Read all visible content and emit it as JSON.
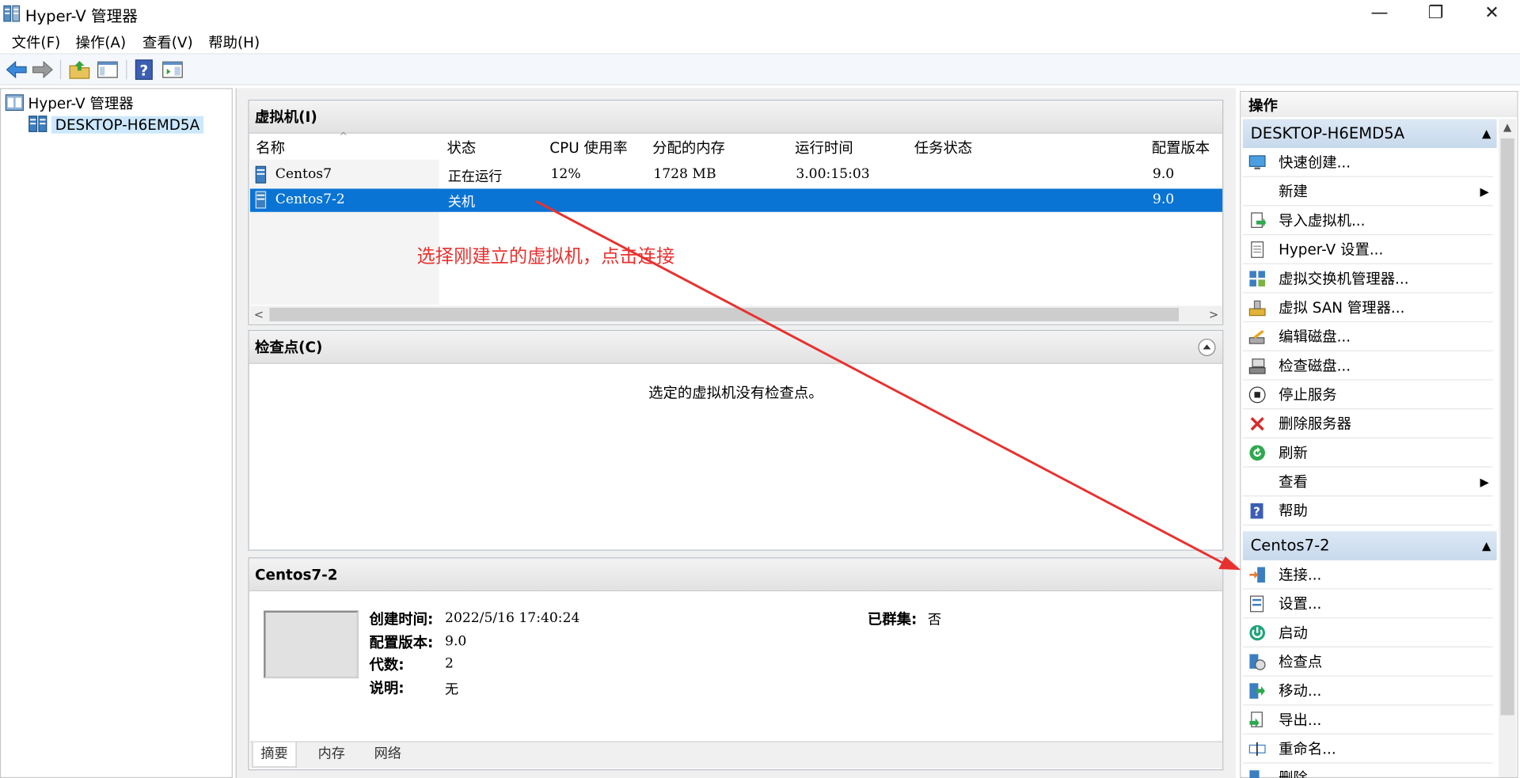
{
  "window": {
    "title": "Hyper-V 管理器",
    "minimize_glyph": "—",
    "restore_glyph": "❐",
    "close_glyph": "✕"
  },
  "menu": [
    "文件(F)",
    "操作(A)",
    "查看(V)",
    "帮助(H)"
  ],
  "tree": {
    "root": "Hyper-V 管理器",
    "server": "DESKTOP-H6EMD5A"
  },
  "vm_panel": {
    "title": "虚拟机(I)",
    "columns": [
      "名称",
      "状态",
      "CPU 使用率",
      "分配的内存",
      "运行时间",
      "任务状态",
      "配置版本"
    ],
    "rows": [
      {
        "name": "Centos7",
        "state": "正在运行",
        "cpu": "12%",
        "memory": "1728 MB",
        "uptime": "3.00:15:03",
        "task": "",
        "version": "9.0"
      },
      {
        "name": "Centos7-2",
        "state": "关机",
        "cpu": "",
        "memory": "",
        "uptime": "",
        "task": "",
        "version": "9.0"
      }
    ],
    "scroll_left": "<",
    "scroll_right": ">"
  },
  "annotation": "选择刚建立的虚拟机，点击连接",
  "checkpoint_panel": {
    "title": "检查点(C)",
    "empty_text": "选定的虚拟机没有检查点。"
  },
  "details_panel": {
    "title": "Centos7-2",
    "fields": [
      {
        "label": "创建时间:",
        "value": "2022/5/16 17:40:24"
      },
      {
        "label": "配置版本:",
        "value": "9.0"
      },
      {
        "label": "代数:",
        "value": "2"
      },
      {
        "label": "说明:",
        "value": "无"
      }
    ],
    "clustered_label": "已群集:",
    "clustered_value": "否",
    "tabs": [
      "摘要",
      "内存",
      "网络"
    ]
  },
  "actions": {
    "title": "操作",
    "server_group": {
      "title": "DESKTOP-H6EMD5A",
      "items": [
        {
          "label": "快速创建...",
          "icon": "monitor-icon"
        },
        {
          "label": "新建",
          "icon": "none",
          "submenu": "▶"
        },
        {
          "label": "导入虚拟机...",
          "icon": "import-icon"
        },
        {
          "label": "Hyper-V 设置...",
          "icon": "document-icon"
        },
        {
          "label": "虚拟交换机管理器...",
          "icon": "switch-icon"
        },
        {
          "label": "虚拟 SAN 管理器...",
          "icon": "san-icon"
        },
        {
          "label": "编辑磁盘...",
          "icon": "edit-disk-icon"
        },
        {
          "label": "检查磁盘...",
          "icon": "inspect-disk-icon"
        },
        {
          "label": "停止服务",
          "icon": "stop-icon"
        },
        {
          "label": "删除服务器",
          "icon": "delete-icon"
        },
        {
          "label": "刷新",
          "icon": "refresh-icon"
        },
        {
          "label": "查看",
          "icon": "none",
          "submenu": "▶"
        },
        {
          "label": "帮助",
          "icon": "help-icon"
        }
      ]
    },
    "vm_group": {
      "title": "Centos7-2",
      "items": [
        {
          "label": "连接...",
          "icon": "connect-icon"
        },
        {
          "label": "设置...",
          "icon": "settings-icon"
        },
        {
          "label": "启动",
          "icon": "power-icon"
        },
        {
          "label": "检查点",
          "icon": "checkpoint-icon"
        },
        {
          "label": "移动...",
          "icon": "move-icon"
        },
        {
          "label": "导出...",
          "icon": "export-icon"
        },
        {
          "label": "重命名...",
          "icon": "rename-icon"
        },
        {
          "label": "删除...",
          "icon": "delete-vm-icon"
        }
      ]
    },
    "collapse_glyph": "▲"
  },
  "colors": {
    "selection": "#0a74d4",
    "annotation": "#e8312f",
    "group_header": "#c7d9ec"
  }
}
